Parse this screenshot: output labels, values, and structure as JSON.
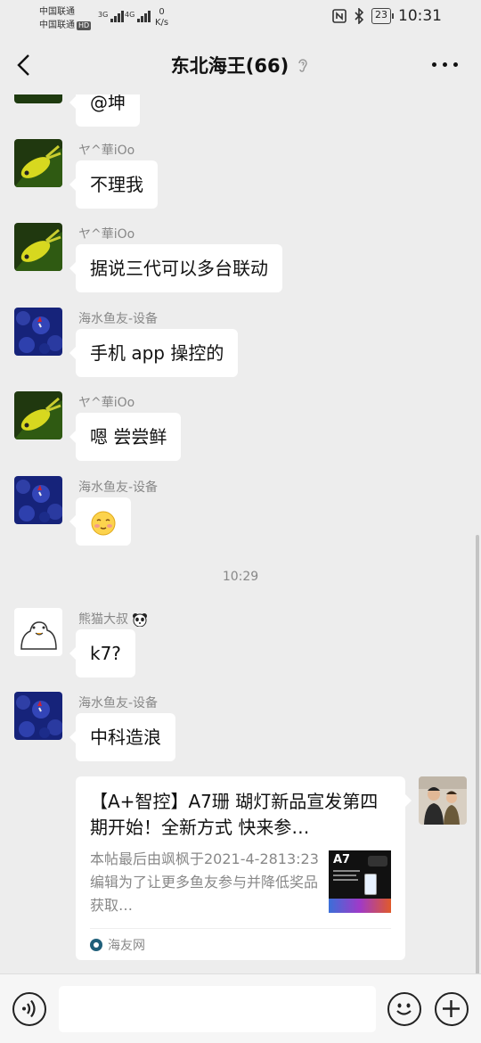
{
  "status_bar": {
    "carrier_1": "中国联通",
    "carrier_2": "中国联通",
    "hd_badge": "HD",
    "signal_1": "3G",
    "signal_2": "4G",
    "speed_value": "0",
    "speed_unit": "K/s",
    "battery": "23",
    "time": "10:31"
  },
  "header": {
    "title": "东北海王(66)",
    "back_icon": "chevron-left-icon",
    "mute_icon": "ear-icon",
    "more_icon": "more-icon"
  },
  "messages": [
    {
      "sender": "",
      "text": "@坤"
    },
    {
      "sender": "ヤ^華iOo",
      "text": "不理我"
    },
    {
      "sender": "ヤ^華iOo",
      "text": "据说三代可以多台联动"
    },
    {
      "sender": "海水鱼友-设备",
      "text": "手机 app 操控的"
    },
    {
      "sender": "ヤ^華iOo",
      "text": "嗯  尝尝鲜"
    },
    {
      "sender": "海水鱼友-设备",
      "emoji": "blush-emoji"
    },
    {
      "timestamp": "10:29"
    },
    {
      "sender": "熊猫大叔",
      "sender_emoji": "panda-emoji",
      "text": "k7?"
    },
    {
      "sender": "海水鱼友-设备",
      "text": "中科造浪"
    }
  ],
  "shared_card": {
    "title": "【A+智控】A7珊 瑚灯新品宣发第四期开始！全新方式  快来参…",
    "description": "本帖最后由飒枫于2021-4-2813:23编辑为了让更多鱼友参与并降低奖品获取…",
    "thumb_label": "A7",
    "source": "海友网"
  },
  "input_bar": {
    "voice_icon": "voice-icon",
    "emoji_icon": "smiley-icon",
    "add_icon": "plus-icon"
  }
}
